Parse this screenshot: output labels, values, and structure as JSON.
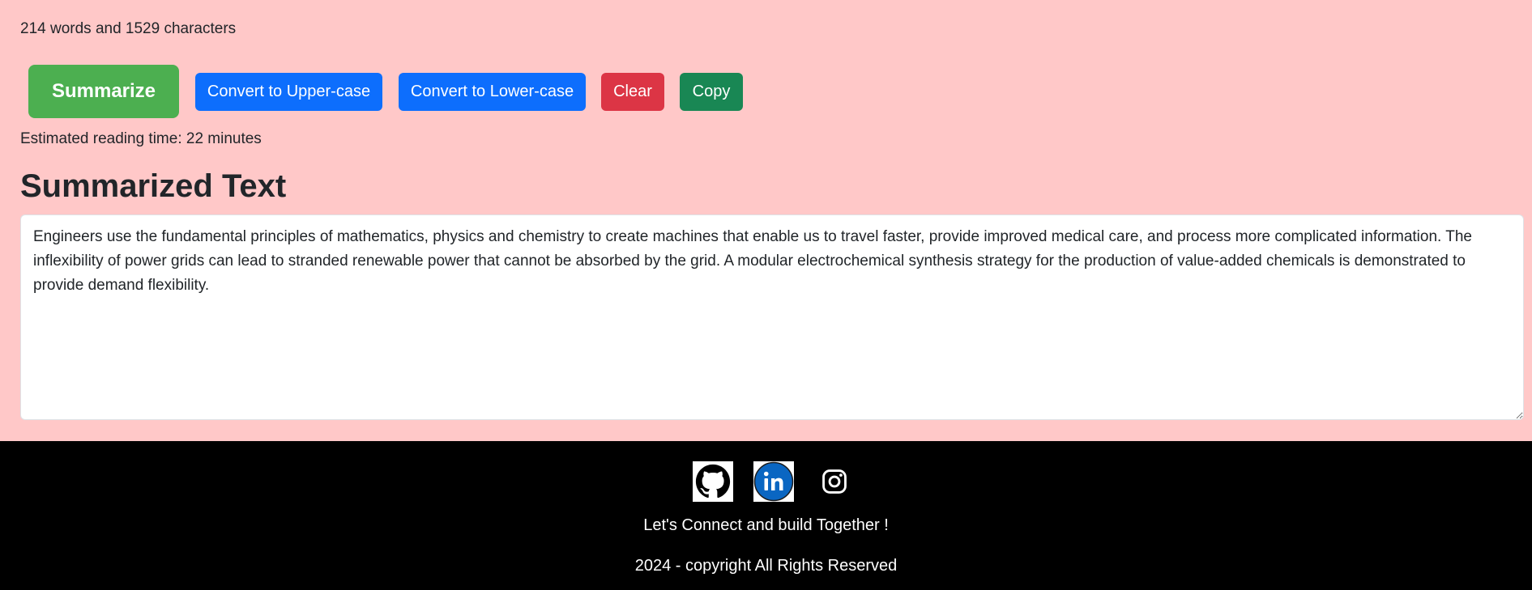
{
  "stats": {
    "summary": "214 words and 1529 characters"
  },
  "toolbar": {
    "summarize_label": "Summarize",
    "upper_label": "Convert to Upper-case",
    "lower_label": "Convert to Lower-case",
    "clear_label": "Clear",
    "copy_label": "Copy"
  },
  "reading": {
    "text": "Estimated reading time: 22 minutes"
  },
  "summary_section": {
    "heading": "Summarized Text",
    "text": "Engineers use the fundamental principles of mathematics, physics and chemistry to create machines that enable us to travel faster, provide improved medical care, and process more complicated information. The inflexibility of power grids can lead to stranded renewable power that cannot be absorbed by the grid. A modular electrochemical synthesis strategy for the production of value-added chemicals is demonstrated to provide demand flexibility."
  },
  "footer": {
    "icons": [
      "github-icon",
      "linkedin-icon",
      "instagram-icon"
    ],
    "tagline": "Let's Connect and build Together !",
    "copyright": "2024 - copyright All Rights Reserved"
  },
  "colors": {
    "page_background": "#ffc8c8",
    "summarize": "#4caf50",
    "primary": "#0d6efd",
    "danger": "#dc3545",
    "success": "#198754",
    "footer_background": "#000000",
    "linkedin_blue": "#0a66c2"
  }
}
